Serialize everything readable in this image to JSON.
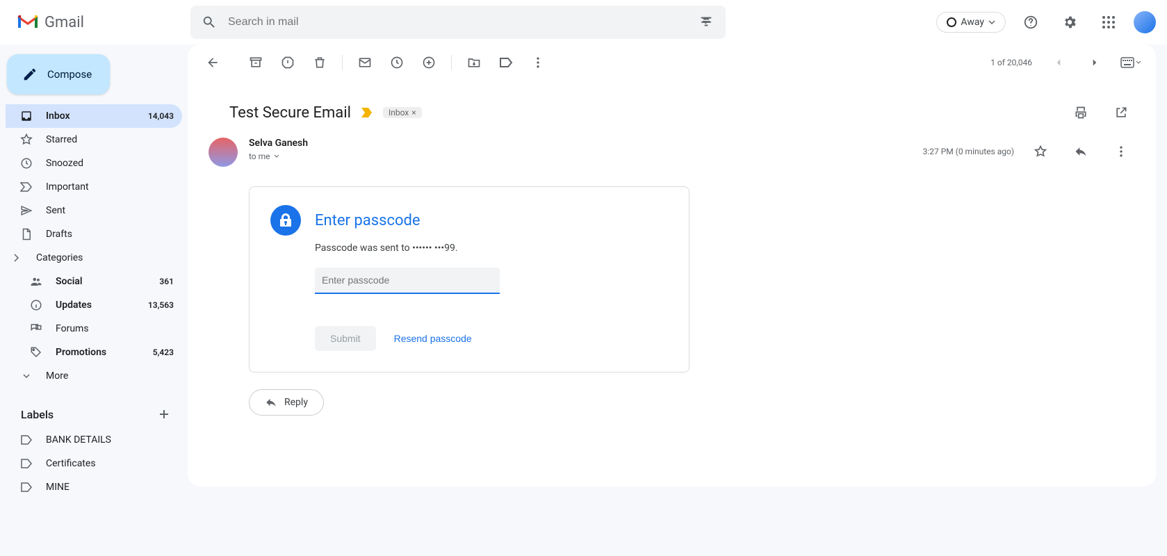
{
  "header": {
    "logo_text": "Gmail",
    "search_placeholder": "Search in mail",
    "status_label": "Away"
  },
  "sidebar": {
    "compose": "Compose",
    "items": [
      {
        "label": "Inbox",
        "count": "14,043",
        "active": true
      },
      {
        "label": "Starred",
        "count": ""
      },
      {
        "label": "Snoozed",
        "count": ""
      },
      {
        "label": "Important",
        "count": ""
      },
      {
        "label": "Sent",
        "count": ""
      },
      {
        "label": "Drafts",
        "count": ""
      },
      {
        "label": "Categories",
        "count": ""
      }
    ],
    "categories": [
      {
        "label": "Social",
        "count": "361"
      },
      {
        "label": "Updates",
        "count": "13,563"
      },
      {
        "label": "Forums",
        "count": ""
      },
      {
        "label": "Promotions",
        "count": "5,423"
      }
    ],
    "more": "More",
    "labels_header": "Labels",
    "labels": [
      {
        "label": "BANK DETAILS"
      },
      {
        "label": "Certificates"
      },
      {
        "label": "MINE"
      }
    ]
  },
  "toolbar": {
    "page_info": "1 of 20,046"
  },
  "message": {
    "subject": "Test Secure Email",
    "label_chip": "Inbox",
    "sender_name": "Selva Ganesh",
    "to_line": "to me",
    "timestamp": "3:27 PM (0 minutes ago)",
    "passcode": {
      "title": "Enter passcode",
      "desc": "Passcode was sent to •••••• •••99.",
      "input_placeholder": "Enter passcode",
      "submit": "Submit",
      "resend": "Resend passcode"
    },
    "reply": "Reply"
  }
}
